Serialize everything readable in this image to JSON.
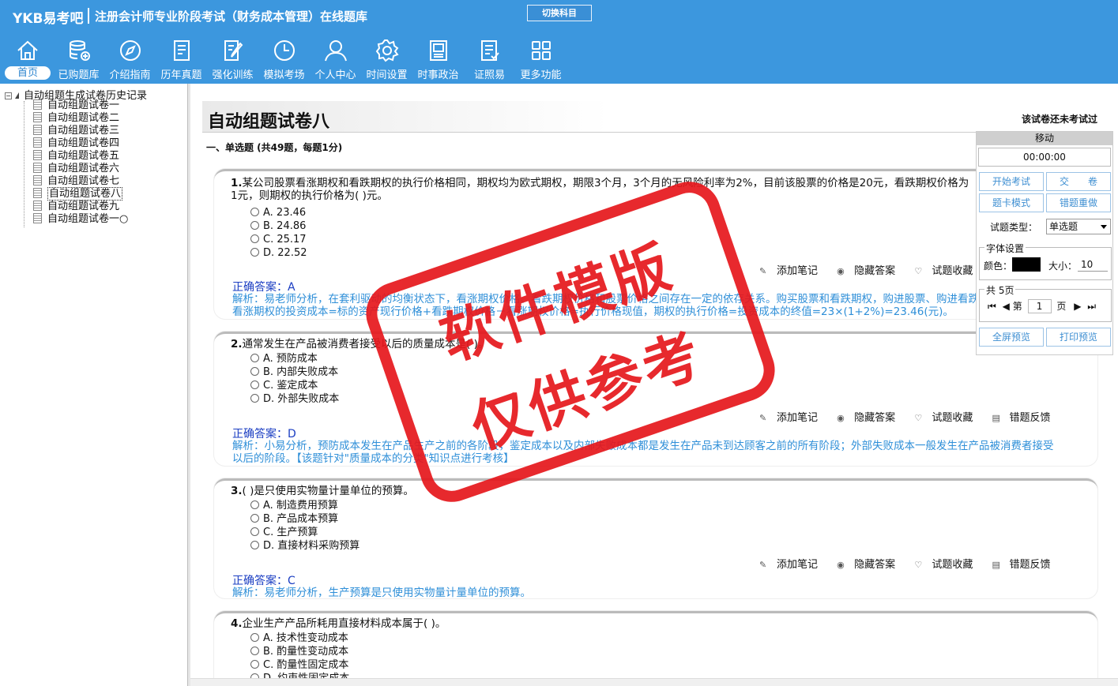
{
  "app": {
    "logo": "YKB易考吧",
    "title": "注册会计师专业阶段考试（财务成本管理）在线题库",
    "switch_label": "切换科目"
  },
  "nav": [
    {
      "label": "首页",
      "icon": "home-icon"
    },
    {
      "label": "已购题库",
      "icon": "database-icon"
    },
    {
      "label": "介绍指南",
      "icon": "compass-icon"
    },
    {
      "label": "历年真题",
      "icon": "list-doc-icon"
    },
    {
      "label": "强化训练",
      "icon": "edit-doc-icon"
    },
    {
      "label": "模拟考场",
      "icon": "clock-icon"
    },
    {
      "label": "个人中心",
      "icon": "user-icon"
    },
    {
      "label": "时间设置",
      "icon": "gear-icon"
    },
    {
      "label": "时事政治",
      "icon": "book-icon"
    },
    {
      "label": "证照易",
      "icon": "checklist-icon"
    },
    {
      "label": "更多功能",
      "icon": "grid-icon"
    }
  ],
  "tree": {
    "root": "自动组题生成试卷历史记录",
    "items": [
      "自动组题试卷一",
      "自动组题试卷二",
      "自动组题试卷三",
      "自动组题试卷四",
      "自动组题试卷五",
      "自动组题试卷六",
      "自动组题试卷七",
      "自动组题试卷八",
      "自动组题试卷九",
      "自动组题试卷一○"
    ],
    "selected_index": 7
  },
  "paper": {
    "title": "自动组题试卷八",
    "status": "该试卷还未考试过",
    "section": "一、单选题 (共49题，每题1分)"
  },
  "action_labels": [
    "添加笔记",
    "隐藏答案",
    "试题收藏",
    "错题反馈"
  ],
  "questions": [
    {
      "num": "1.",
      "text": "某公司股票看涨期权和看跌期权的执行价格相同，期权均为欧式期权，期限3个月，3个月的无风险利率为2%，目前该股票的价格是20元，看跌期权价格为1元，则期权的执行价格为( )元。",
      "options": [
        "A. 23.46",
        "B. 24.86",
        "C. 25.17",
        "D. 22.52"
      ],
      "answer": "正确答案：A",
      "analysis": "解析：易老师分析，在套利驱动的均衡状态下，看涨期权价格、看跌期权价格和股票价格之间存在一定的依存关系。购买股票和看跌期权，购进股票、购进看跌期权，同时售出看涨期权的投资成本=标的资产现行价格+看跌期权价格－看涨期权价格=执行价格现值，期权的执行价格=投资成本的终值=23×(1+2%)=23.46(元)。"
    },
    {
      "num": "2.",
      "text": "通常发生在产品被消费者接受以后的质量成本是( )。",
      "options": [
        "A. 预防成本",
        "B. 内部失败成本",
        "C. 鉴定成本",
        "D. 外部失败成本"
      ],
      "answer": "正确答案：D",
      "analysis": "解析：小易分析，预防成本发生在产品生产之前的各阶段，鉴定成本以及内部失败成本都是发生在产品未到达顾客之前的所有阶段；外部失败成本一般发生在产品被消费者接受以后的阶段。【该题针对\"质量成本的分类\"知识点进行考核】"
    },
    {
      "num": "3.",
      "text": "( )是只使用实物量计量单位的预算。",
      "options": [
        "A. 制造费用预算",
        "B. 产品成本预算",
        "C. 生产预算",
        "D. 直接材料采购预算"
      ],
      "answer": "正确答案：C",
      "analysis": "解析：易老师分析，生产预算是只使用实物量计量单位的预算。"
    },
    {
      "num": "4.",
      "text": "企业生产产品所耗用直接材料成本属于( )。",
      "options": [
        "A. 技术性变动成本",
        "B. 酌量性变动成本",
        "C. 酌量性固定成本",
        "D. 约束性固定成本"
      ],
      "answer": "",
      "analysis": ""
    }
  ],
  "panel": {
    "move": "移动",
    "timer": "00:00:00",
    "start": "开始考试",
    "submit": "交　　卷",
    "card_mode": "题卡模式",
    "redo_wrong": "错题重做",
    "type_label": "试题类型：",
    "type_value": "单选题",
    "font_legend": "字体设置",
    "color_label": "颜色：",
    "size_label": "大小：",
    "size_value": "10",
    "page_legend": "共 5页",
    "page_prefix": "第",
    "page_value": "1",
    "page_suffix": "页",
    "fullscreen": "全屏预览",
    "print": "打印预览"
  },
  "watermark": {
    "line1": "软件模版",
    "line2": "仅供参考"
  },
  "colors": {
    "header": "#3c97de",
    "answer": "#1a3dc2",
    "analysis": "#2f8fd8",
    "stamp": "#e6171c"
  }
}
